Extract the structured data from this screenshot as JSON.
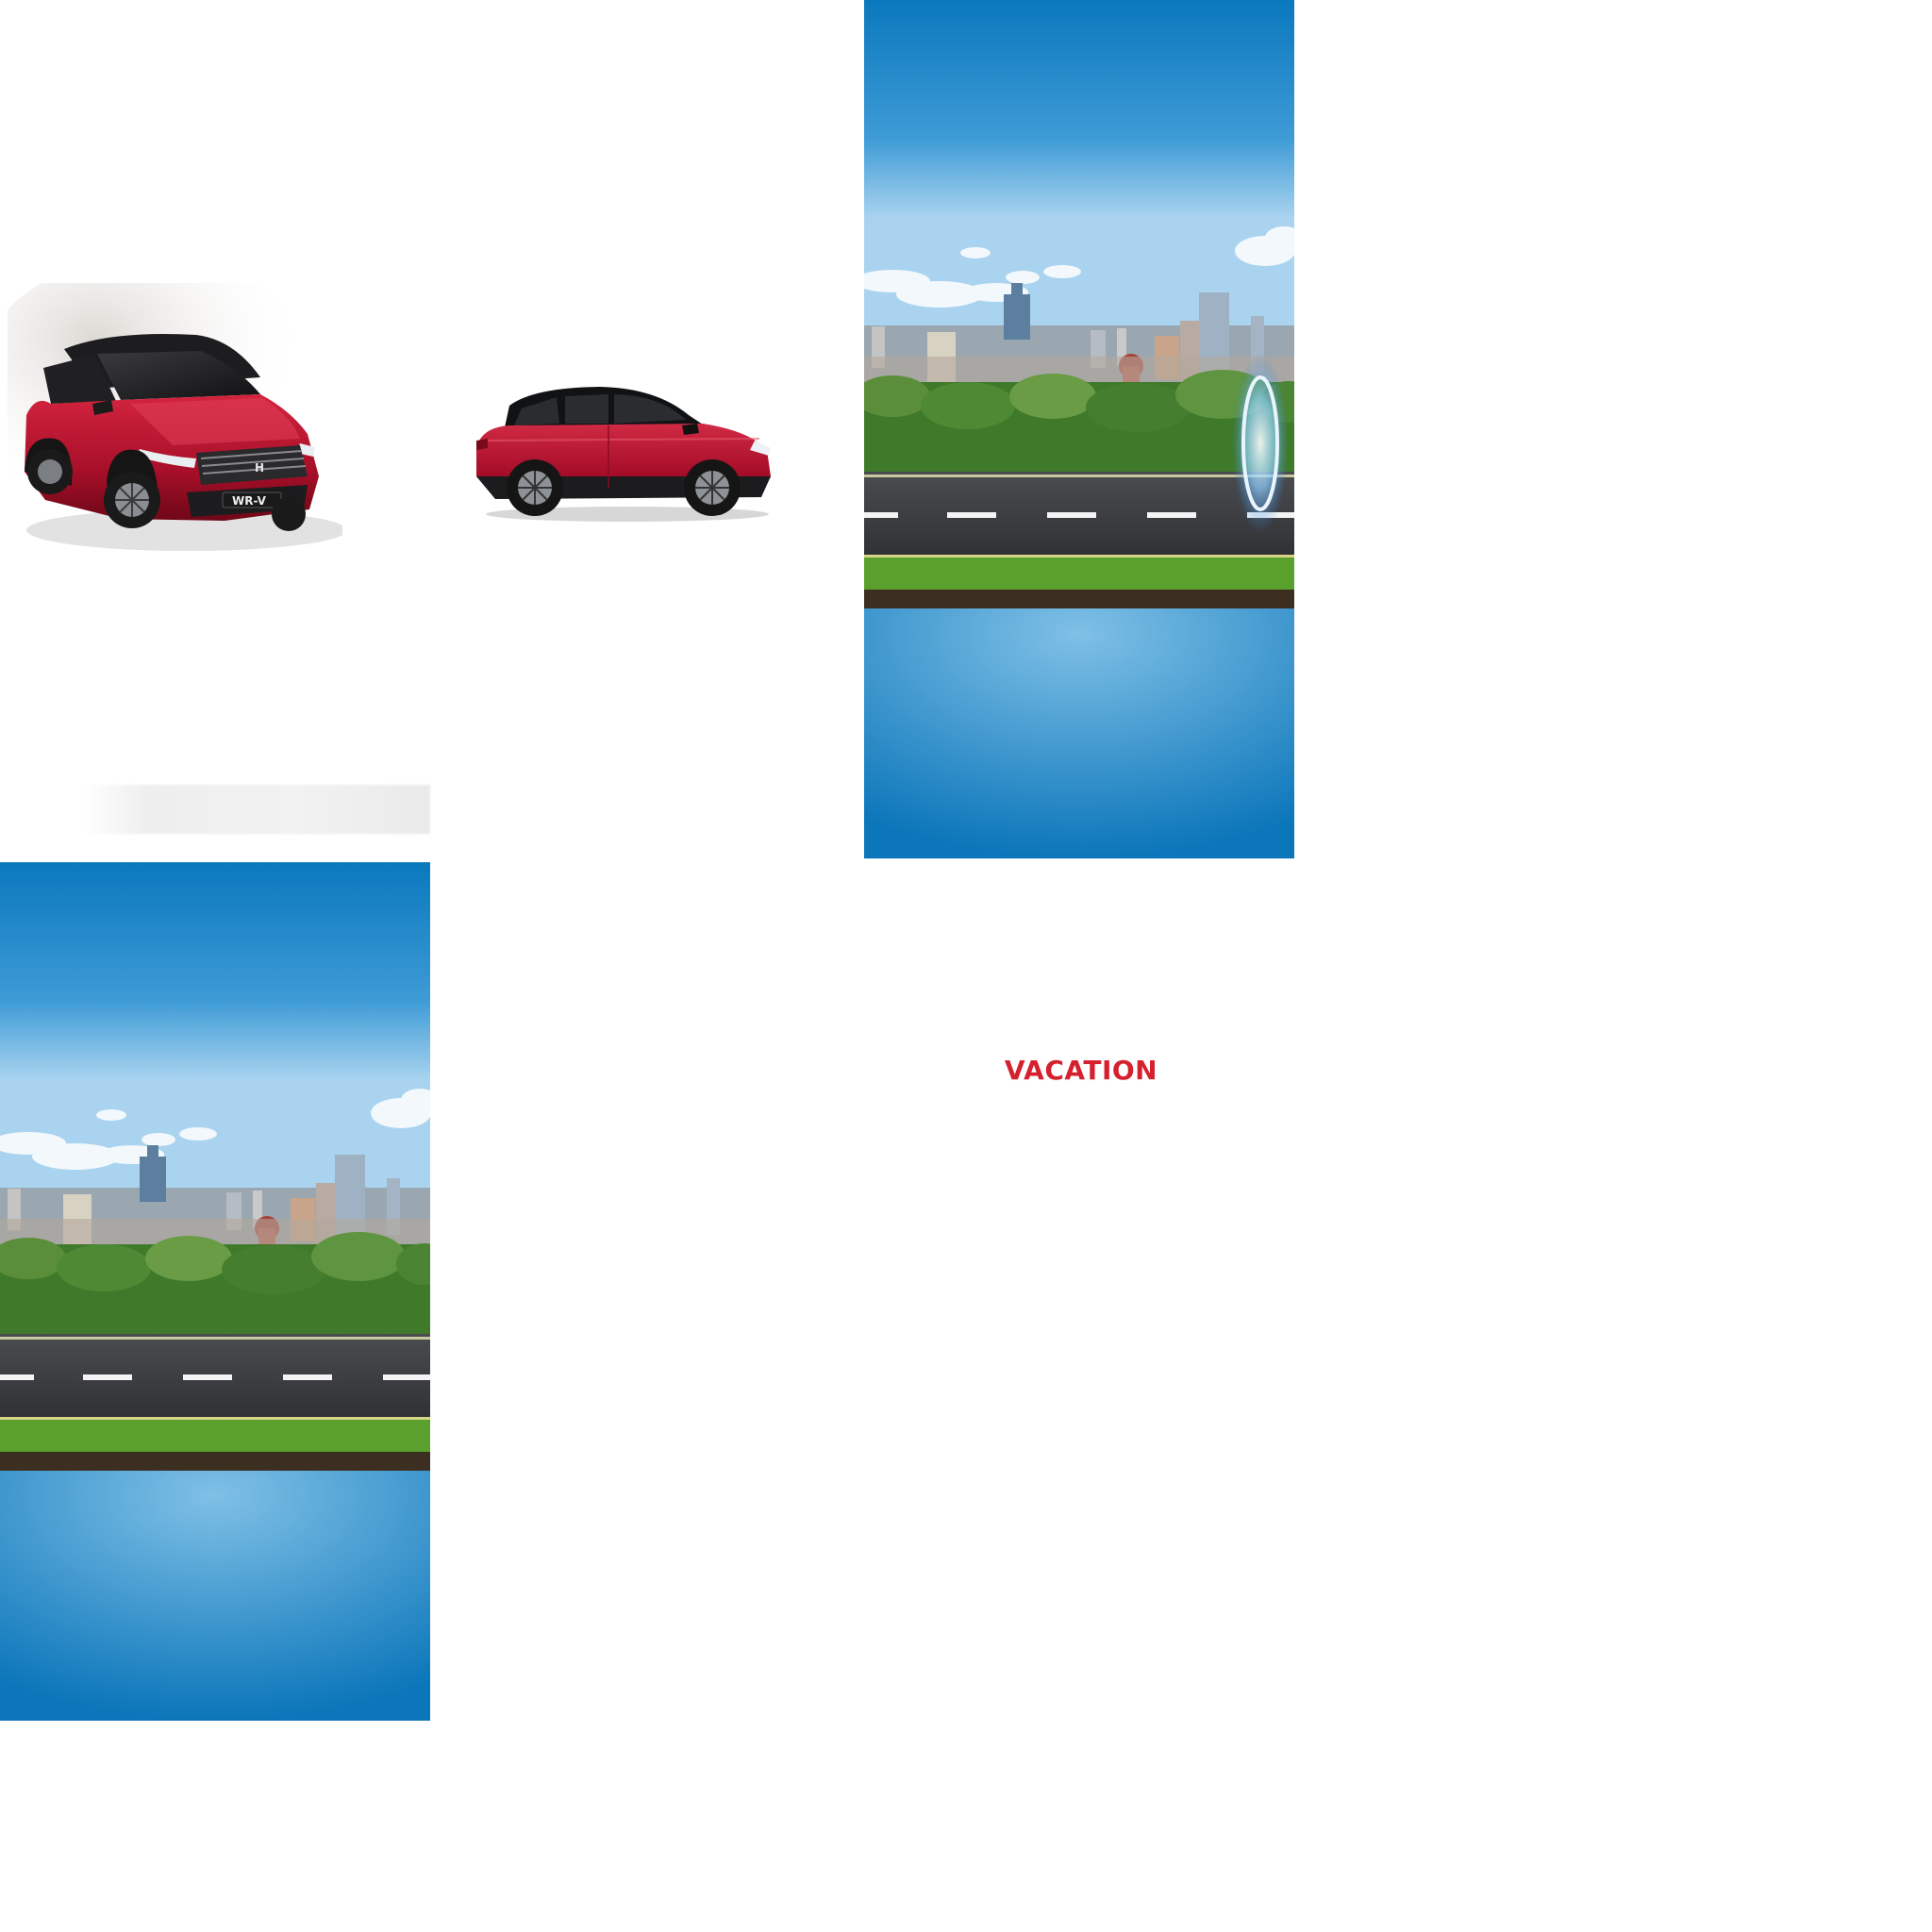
{
  "canvas": {
    "background": "#ffffff"
  },
  "cars": [
    {
      "id": "front-view",
      "color": "#b3122e",
      "roof_color": "#1a1a1a",
      "badge": "WR-V",
      "logo": "H"
    },
    {
      "id": "side-view",
      "color": "#b3122e",
      "roof_color": "#1a1a1a"
    }
  ],
  "scene": {
    "sky_top": "#0a78bd",
    "sky_light": "#7fc0e6",
    "road_color": "#3d3f42",
    "grass_color": "#4f9a2a",
    "portal_color": "#bfe3ff"
  },
  "tagline": {
    "text": "VACATION",
    "color": "#d5202e"
  }
}
